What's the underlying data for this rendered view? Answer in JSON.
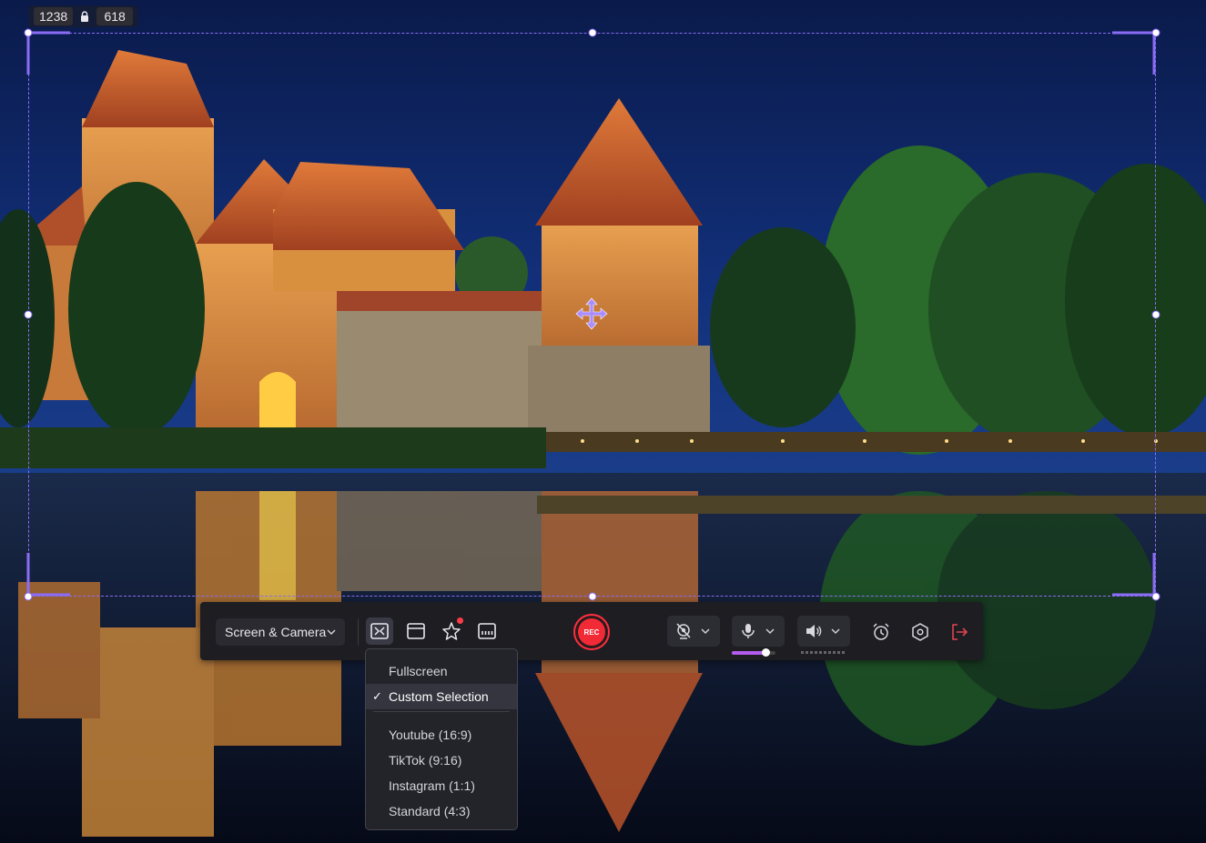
{
  "selection": {
    "width_label": "1238",
    "height_label": "618",
    "accent_color": "#8b6cf5"
  },
  "toolbar": {
    "mode_label": "Screen & Camera",
    "capture_icons": [
      "custom-region-icon",
      "window-icon",
      "effects-icon",
      "subtitles-icon"
    ],
    "rec_label": "REC",
    "webcam_icon": "camera-off-icon",
    "mic_icon": "microphone-icon",
    "mic_level": 0.78,
    "speaker_icon": "speaker-icon",
    "timer_icon": "alarm-clock-icon",
    "settings_icon": "settings-icon",
    "exit_icon": "exit-icon",
    "rec_color": "#f12a36",
    "exit_color": "#e0454f"
  },
  "menu": {
    "items": [
      {
        "label": "Fullscreen",
        "selected": false
      },
      {
        "label": "Custom Selection",
        "selected": true
      },
      {
        "label": "Youtube (16:9)",
        "selected": false
      },
      {
        "label": "TikTok (9:16)",
        "selected": false
      },
      {
        "label": "Instagram (1:1)",
        "selected": false
      },
      {
        "label": "Standard (4:3)",
        "selected": false
      }
    ],
    "check_glyph": "✓"
  }
}
